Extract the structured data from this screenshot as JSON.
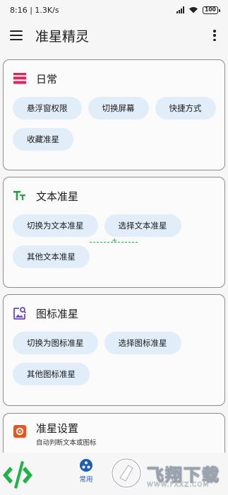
{
  "status_bar": {
    "time_speed": "8:16 | 1.3K/s",
    "battery": "100"
  },
  "app_bar": {
    "title": "准星精灵"
  },
  "sections": {
    "daily": {
      "title": "日常",
      "chips": [
        "悬浮窗权限",
        "切换屏幕",
        "快捷方式",
        "收藏准星"
      ]
    },
    "text_crosshair": {
      "title": "文本准星",
      "chips": [
        "切换为文本准星",
        "选择文本准星",
        "其他文本准星"
      ]
    },
    "icon_crosshair": {
      "title": "图标准星",
      "chips": [
        "切换为图标准星",
        "选择图标准星",
        "其他图标准星"
      ]
    },
    "settings": {
      "title": "准星设置",
      "subtitle": "自动判断文本或图标"
    }
  },
  "bottom_nav": {
    "home_label": "常用"
  },
  "watermark": {
    "text": "飞翔下载",
    "url": "WWW.FXXZ.COM"
  },
  "colors": {
    "chip_bg": "#e1eef9",
    "daily_icon": "#e0245e",
    "text_icon": "#2e9d49",
    "image_icon": "#6b46c1",
    "settings_icon": "#e8551f",
    "nav_active": "#1e5fb4"
  }
}
